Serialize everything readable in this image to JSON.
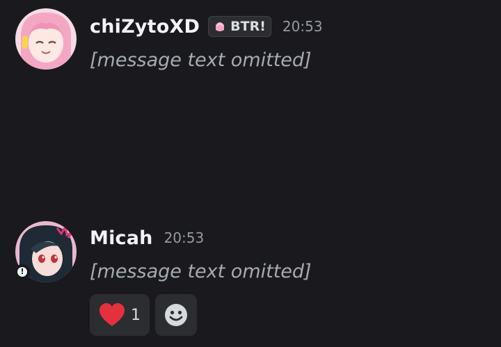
{
  "messages": [
    {
      "username": "chiZytoXD",
      "server_tag": "BTR!",
      "timestamp": "20:53",
      "body": "[message text omitted]"
    },
    {
      "username": "Micah",
      "timestamp": "20:53",
      "body": "[message text omitted]",
      "reactions": [
        {
          "emoji": "red-heart",
          "count": "1"
        }
      ]
    }
  ],
  "colors": {
    "background": "#1a1a1e",
    "username": "#f2f3f5",
    "timestamp": "#949ba4",
    "heart": "#e5303e",
    "avatar_pink": "#f4a7c3"
  },
  "icons": [
    "tag-gem-icon",
    "status-dot-icon",
    "heart-emoji-icon",
    "add-reaction-icon"
  ]
}
